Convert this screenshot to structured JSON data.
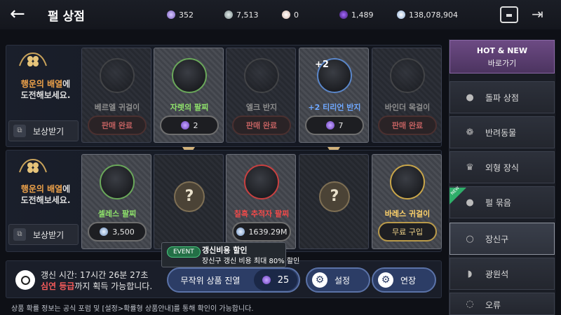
{
  "header": {
    "title": "펄 상점"
  },
  "currencies": [
    {
      "icon": "purple-crystal-icon",
      "value": "352",
      "color": "#b79cf5"
    },
    {
      "icon": "silver-coin-icon",
      "value": "7,513",
      "color": "#b8c4c4"
    },
    {
      "icon": "pearl-icon",
      "value": "0",
      "color": "#f0d9d0"
    },
    {
      "icon": "dark-purple-gem-icon",
      "value": "1,489",
      "color": "#6a2fb0"
    },
    {
      "icon": "silver-money-icon",
      "value": "138,078,904",
      "color": "#cfe0f5"
    }
  ],
  "promo": {
    "highlight": "행운의 배열",
    "suffix": "에",
    "line2": "도전해보세요.",
    "reward_label": "보상받기"
  },
  "row1": [
    {
      "name": "베르엘 귀걸이",
      "status": "판매 완료",
      "state": "sold"
    },
    {
      "name": "자렛의 팔찌",
      "price": "2",
      "currency": "gem",
      "name_color": "#8fe36b"
    },
    {
      "name": "엘크 반지",
      "status": "판매 완료",
      "state": "sold"
    },
    {
      "name": "+2 티리언 반지",
      "price": "7",
      "currency": "gem",
      "name_color": "#6fa8ff",
      "badge": "+2"
    },
    {
      "name": "바인더 목걸이",
      "status": "판매 완료",
      "state": "sold"
    }
  ],
  "row2": [
    {
      "name": "셀레스 팔찌",
      "price": "3,500",
      "currency": "coin",
      "name_color": "#8fe36b"
    },
    {
      "mystery": "?"
    },
    {
      "name": "칠흑 추적자 팔찌",
      "price": "1639.29M",
      "currency": "coin",
      "name_color": "#f04a4a"
    },
    {
      "mystery": "?"
    },
    {
      "name": "바레스 귀걸이",
      "status": "무료 구입",
      "state": "free",
      "name_color": "#ffd36a"
    }
  ],
  "sidebar": {
    "hot_title": "HOT & NEW",
    "hot_sub": "바로가기",
    "items": [
      {
        "label": "돌파 상점",
        "icon": "breakthrough-icon"
      },
      {
        "label": "반려동물",
        "icon": "paw-icon"
      },
      {
        "label": "외형 장식",
        "icon": "costume-icon"
      },
      {
        "label": "펄 묶음",
        "icon": "pearl-bundle-icon",
        "badge": "NEW"
      },
      {
        "label": "장신구",
        "icon": "accessory-icon",
        "active": true
      },
      {
        "label": "광원석",
        "icon": "ore-icon"
      },
      {
        "label": "오류",
        "icon": "misc-icon"
      }
    ]
  },
  "bottom": {
    "refresh_time": "갱신 시간: 17시간 26분 27초",
    "grade": "심연 등급",
    "grade_suffix": "까지 획득 가능합니다.",
    "random_label": "무작위 상품 진열",
    "random_cost": "25",
    "settings_label": "설정",
    "extend_label": "연장"
  },
  "event": {
    "tag": "EVENT",
    "title": "갱신비용 할인",
    "desc": "장신구 갱신 비용 최대 80% 할인"
  },
  "footer": "상품 확률 정보는 공식 포럼 및 [설정>확률형 상품안내]를 통해 확인이 가능합니다."
}
